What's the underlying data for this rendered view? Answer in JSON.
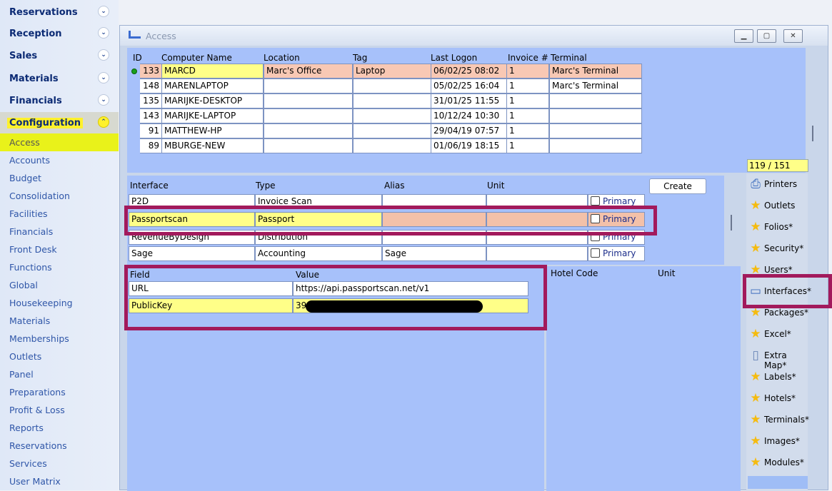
{
  "sidebar": {
    "sections": [
      {
        "label": "Reservations"
      },
      {
        "label": "Reception"
      },
      {
        "label": "Sales"
      },
      {
        "label": "Materials"
      },
      {
        "label": "Financials"
      },
      {
        "label": "Configuration"
      }
    ],
    "items": [
      "Access",
      "Accounts",
      "Budget",
      "Consolidation",
      "Facilities",
      "Financials",
      "Front Desk",
      "Functions",
      "Global",
      "Housekeeping",
      "Materials",
      "Memberships",
      "Outlets",
      "Panel",
      "Preparations",
      "Profit & Loss",
      "Reports",
      "Reservations",
      "Services",
      "User Matrix"
    ],
    "selected": "Access"
  },
  "window": {
    "title": "Access"
  },
  "computers": {
    "headers": [
      "ID",
      "Computer Name",
      "Location",
      "Tag",
      "Last Logon",
      "Invoice #",
      "Terminal"
    ],
    "rows": [
      {
        "id": "133",
        "name": "MARCD",
        "location": "Marc's Office",
        "tag": "Laptop",
        "logon": "06/02/25 08:02",
        "invoice": "1",
        "terminal": "Marc's Terminal"
      },
      {
        "id": "148",
        "name": "MARENLAPTOP",
        "location": "",
        "tag": "",
        "logon": "05/02/25 16:04",
        "invoice": "1",
        "terminal": "Marc's Terminal"
      },
      {
        "id": "135",
        "name": "MARIJKE-DESKTOP",
        "location": "",
        "tag": "",
        "logon": "31/01/25 11:55",
        "invoice": "1",
        "terminal": ""
      },
      {
        "id": "143",
        "name": "MARIJKE-LAPTOP",
        "location": "",
        "tag": "",
        "logon": "10/12/24 10:30",
        "invoice": "1",
        "terminal": ""
      },
      {
        "id": "91",
        "name": "MATTHEW-HP",
        "location": "",
        "tag": "",
        "logon": "29/04/19 07:57",
        "invoice": "1",
        "terminal": ""
      },
      {
        "id": "89",
        "name": "MBURGE-NEW",
        "location": "",
        "tag": "",
        "logon": "01/06/19 18:15",
        "invoice": "1",
        "terminal": ""
      }
    ],
    "counter": "119 / 151"
  },
  "interfaces": {
    "headers": [
      "Interface",
      "Type",
      "Alias",
      "Unit"
    ],
    "create_label": "Create",
    "primary_label": "Primary",
    "rows": [
      {
        "interface": "P2D",
        "type": "Invoice Scan",
        "alias": "",
        "unit": ""
      },
      {
        "interface": "Passportscan",
        "type": "Passport",
        "alias": "",
        "unit": ""
      },
      {
        "interface": "RevenueByDesign",
        "type": "Distribution",
        "alias": "",
        "unit": ""
      },
      {
        "interface": "Sage",
        "type": "Accounting",
        "alias": "Sage",
        "unit": ""
      }
    ]
  },
  "fields": {
    "headers": [
      "Field",
      "Value"
    ],
    "rows": [
      {
        "field": "URL",
        "value": "https://api.passportscan.net/v1"
      },
      {
        "field": "PublicKey",
        "value": "39"
      }
    ]
  },
  "hotels": {
    "headers": [
      "Hotel Code",
      "Unit"
    ]
  },
  "rightmenu": [
    {
      "label": "Printers",
      "icon": "printer-icon"
    },
    {
      "label": "Outlets",
      "icon": "star-icon"
    },
    {
      "label": "Folios*",
      "icon": "star-icon"
    },
    {
      "label": "Security*",
      "icon": "star-icon"
    },
    {
      "label": "Users*",
      "icon": "star-icon"
    },
    {
      "label": "Interfaces*",
      "icon": "monitor-icon"
    },
    {
      "label": "Packages*",
      "icon": "star-icon"
    },
    {
      "label": "Excel*",
      "icon": "star-icon"
    },
    {
      "label": "Extra Map*",
      "icon": "document-icon"
    },
    {
      "label": "Labels*",
      "icon": "star-icon"
    },
    {
      "label": "Hotels*",
      "icon": "star-icon"
    },
    {
      "label": "Terminals*",
      "icon": "star-icon"
    },
    {
      "label": "Images*",
      "icon": "star-icon"
    },
    {
      "label": "Modules*",
      "icon": "star-icon"
    }
  ],
  "colors": {
    "highlight": "#ffff88",
    "selected_peach": "#f8c8b4",
    "annotation": "#a21a5c",
    "panel": "#a7c1fa"
  }
}
